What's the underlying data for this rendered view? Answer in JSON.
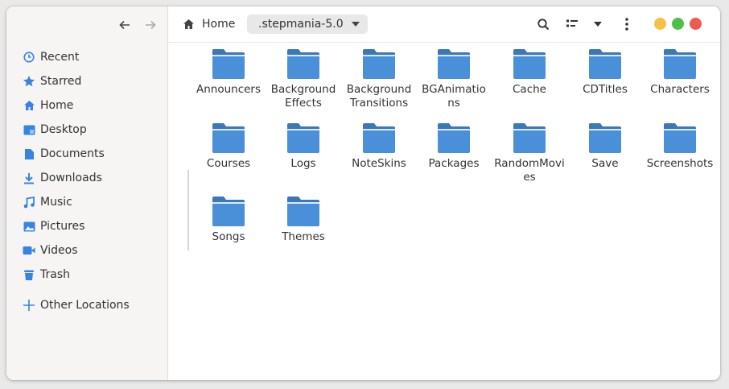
{
  "sidebar": {
    "items": [
      {
        "label": "Recent",
        "icon": "clock-icon"
      },
      {
        "label": "Starred",
        "icon": "star-icon"
      },
      {
        "label": "Home",
        "icon": "home-icon"
      },
      {
        "label": "Desktop",
        "icon": "desktop-icon"
      },
      {
        "label": "Documents",
        "icon": "document-icon"
      },
      {
        "label": "Downloads",
        "icon": "download-icon"
      },
      {
        "label": "Music",
        "icon": "music-icon"
      },
      {
        "label": "Pictures",
        "icon": "picture-icon"
      },
      {
        "label": "Videos",
        "icon": "video-icon"
      },
      {
        "label": "Trash",
        "icon": "trash-icon"
      }
    ],
    "other_locations": "Other Locations"
  },
  "breadcrumb": {
    "home": "Home",
    "current": ".stepmania-5.0"
  },
  "colors": {
    "accent": "#3584e4",
    "folder": "#4a90d9",
    "folder_dark": "#3b78b8",
    "minimize": "#f5c243",
    "maximize": "#4fbf45",
    "close": "#ec5a50"
  },
  "folders": [
    {
      "name": "Announcers"
    },
    {
      "name": "Background Effects"
    },
    {
      "name": "Background Transitions"
    },
    {
      "name": "BGAnimations"
    },
    {
      "name": "Cache"
    },
    {
      "name": "CDTitles"
    },
    {
      "name": "Characters"
    },
    {
      "name": "Courses"
    },
    {
      "name": "Logs"
    },
    {
      "name": "NoteSkins"
    },
    {
      "name": "Packages"
    },
    {
      "name": "RandomMovies"
    },
    {
      "name": "Save"
    },
    {
      "name": "Screenshots"
    },
    {
      "name": "Songs"
    },
    {
      "name": "Themes"
    }
  ]
}
